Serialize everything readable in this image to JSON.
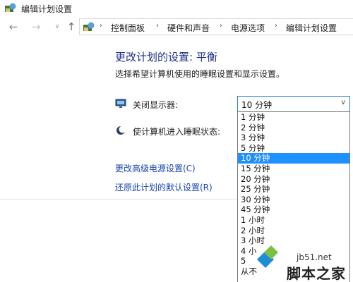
{
  "window": {
    "title": "编辑计划设置"
  },
  "nav": {
    "back": "←",
    "forward": "→",
    "history": "∨",
    "up": "↑"
  },
  "breadcrumb": {
    "items": [
      "控制面板",
      "硬件和声音",
      "电源选项",
      "编辑计划设置"
    ],
    "separator": "›"
  },
  "main": {
    "heading": "更改计划的设置: 平衡",
    "subtext": "选择希望计算机使用的睡眠设置和显示设置。",
    "display_off": {
      "label": "关闭显示器:",
      "value": "10 分钟",
      "arrow": "∨"
    },
    "sleep": {
      "label": "使计算机进入睡眠状态:"
    },
    "links": {
      "advanced": "更改高级电源设置(C)",
      "restore": "还原此计划的默认设置(R)"
    }
  },
  "dropdown": {
    "options": [
      "1 分钟",
      "2 分钟",
      "3 分钟",
      "5 分钟",
      "10 分钟",
      "15 分钟",
      "20 分钟",
      "25 分钟",
      "30 分钟",
      "45 分钟",
      "1 小时",
      "2 小时",
      "3 小时",
      "4 小",
      "5",
      "从不"
    ],
    "selected_index": 4
  },
  "watermark": {
    "site": "jb51.net",
    "text": "脚本之家"
  },
  "colors": {
    "accent": "#1e90ff",
    "heading": "#1e3287",
    "link": "#1a44b0"
  },
  "icons": [
    "control-panel-icon",
    "monitor-icon",
    "moon-icon"
  ]
}
